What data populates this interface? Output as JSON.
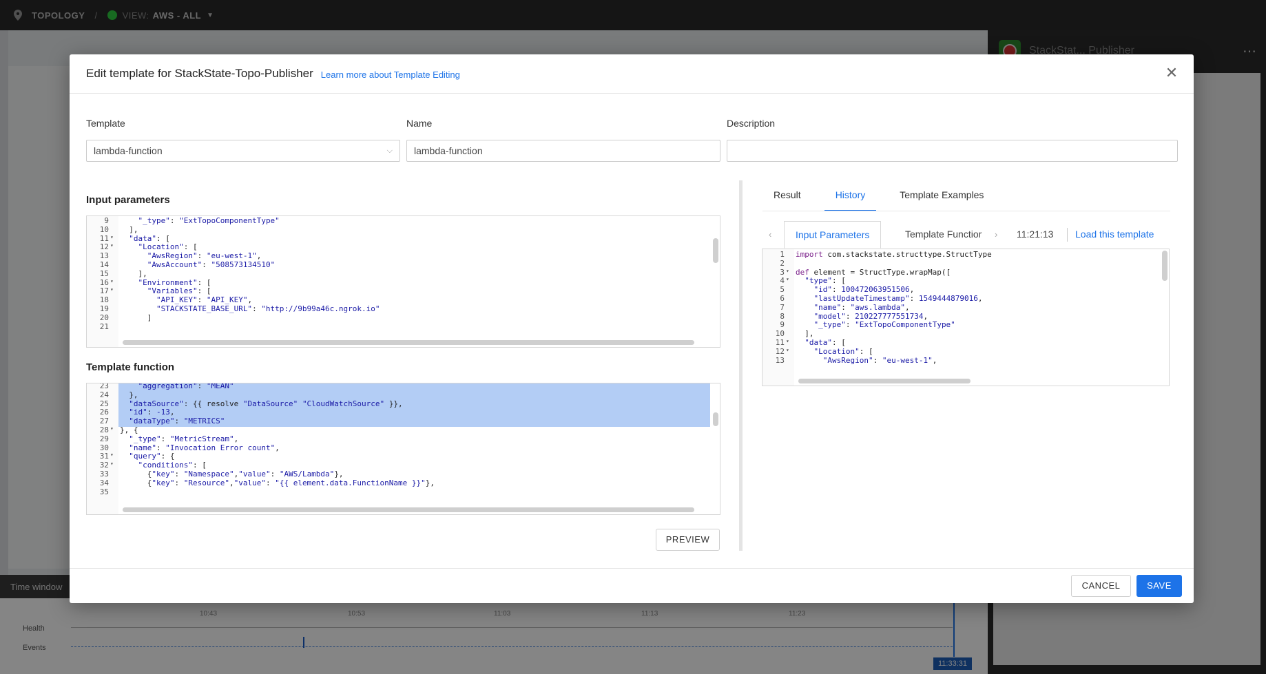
{
  "topbar": {
    "crumb": "TOPOLOGY",
    "separator": "/",
    "view_prefix": "VIEW:",
    "view_name": "AWS - ALL",
    "status_color": "#2ecc40"
  },
  "background": {
    "time_window_label": "Time window",
    "timeline": {
      "health_label": "Health",
      "events_label": "Events",
      "ticks": [
        "10:43",
        "10:53",
        "11:03",
        "11:13",
        "11:23"
      ],
      "current_time": "11:33:31"
    },
    "right_panel_title": "StackStat... Publisher"
  },
  "modal": {
    "title": "Edit template for StackState-Topo-Publisher",
    "learn_link": "Learn more about Template Editing",
    "fields": {
      "template_label": "Template",
      "template_value": "lambda-function",
      "name_label": "Name",
      "name_value": "lambda-function",
      "description_label": "Description",
      "description_value": ""
    },
    "input_parameters": {
      "title": "Input parameters",
      "lines": [
        {
          "n": "9",
          "fold": "",
          "text": "    \"_type\": \"ExtTopoComponentType\""
        },
        {
          "n": "10",
          "fold": "",
          "text": "  ],"
        },
        {
          "n": "11",
          "fold": "▾",
          "text": "  \"data\": ["
        },
        {
          "n": "12",
          "fold": "▾",
          "text": "    \"Location\": ["
        },
        {
          "n": "13",
          "fold": "",
          "text": "      \"AwsRegion\": \"eu-west-1\","
        },
        {
          "n": "14",
          "fold": "",
          "text": "      \"AwsAccount\": \"508573134510\""
        },
        {
          "n": "15",
          "fold": "",
          "text": "    ],"
        },
        {
          "n": "16",
          "fold": "▾",
          "text": "    \"Environment\": ["
        },
        {
          "n": "17",
          "fold": "▾",
          "text": "      \"Variables\": ["
        },
        {
          "n": "18",
          "fold": "",
          "text": "        \"API_KEY\": \"API_KEY\","
        },
        {
          "n": "19",
          "fold": "",
          "text": "        \"STACKSTATE_BASE_URL\": \"http://9b99a46c.ngrok.io\""
        },
        {
          "n": "20",
          "fold": "",
          "text": "      ]"
        },
        {
          "n": "21",
          "fold": "",
          "text": ""
        }
      ]
    },
    "template_function": {
      "title": "Template function",
      "lines": [
        {
          "n": "23",
          "fold": "",
          "text": "    \"aggregation\": \"MEAN\"",
          "sel": true
        },
        {
          "n": "24",
          "fold": "",
          "text": "  },",
          "sel": true
        },
        {
          "n": "25",
          "fold": "",
          "text": "  \"dataSource\": {{ resolve \"DataSource\" \"CloudWatchSource\" }},",
          "sel": true
        },
        {
          "n": "26",
          "fold": "",
          "text": "  \"id\": -13,",
          "sel": true
        },
        {
          "n": "27",
          "fold": "",
          "text": "  \"dataType\": \"METRICS\"",
          "sel": true
        },
        {
          "n": "28",
          "fold": "▾",
          "text": "}, {",
          "sel": false
        },
        {
          "n": "29",
          "fold": "",
          "text": "  \"_type\": \"MetricStream\",",
          "sel": false
        },
        {
          "n": "30",
          "fold": "",
          "text": "  \"name\": \"Invocation Error count\",",
          "sel": false
        },
        {
          "n": "31",
          "fold": "▾",
          "text": "  \"query\": {",
          "sel": false
        },
        {
          "n": "32",
          "fold": "▾",
          "text": "    \"conditions\": [",
          "sel": false
        },
        {
          "n": "33",
          "fold": "",
          "text": "      {\"key\": \"Namespace\",\"value\": \"AWS/Lambda\"},",
          "sel": false
        },
        {
          "n": "34",
          "fold": "",
          "text": "      {\"key\": \"Resource\",\"value\": \"{{ element.data.FunctionName }}\"},",
          "sel": false
        },
        {
          "n": "35",
          "fold": "",
          "text": "",
          "sel": false
        }
      ]
    },
    "preview_label": "PREVIEW",
    "right_tabs": [
      "Result",
      "History",
      "Template Examples"
    ],
    "active_right_tab": "History",
    "history": {
      "subtab_active": "Input Parameters",
      "subtab_other": "Template Functior",
      "prev_arrow": "‹",
      "next_arrow": "›",
      "timestamp": "11:21:13",
      "load_link": "Load this template",
      "lines": [
        {
          "n": "1",
          "fold": "",
          "text": "import com.stackstate.structtype.StructType"
        },
        {
          "n": "2",
          "fold": "",
          "text": ""
        },
        {
          "n": "3",
          "fold": "▾",
          "text": "def element = StructType.wrapMap(["
        },
        {
          "n": "4",
          "fold": "▾",
          "text": "  \"type\": ["
        },
        {
          "n": "5",
          "fold": "",
          "text": "    \"id\": 100472063951506,"
        },
        {
          "n": "6",
          "fold": "",
          "text": "    \"lastUpdateTimestamp\": 1549444879016,"
        },
        {
          "n": "7",
          "fold": "",
          "text": "    \"name\": \"aws.lambda\","
        },
        {
          "n": "8",
          "fold": "",
          "text": "    \"model\": 210227777551734,"
        },
        {
          "n": "9",
          "fold": "",
          "text": "    \"_type\": \"ExtTopoComponentType\""
        },
        {
          "n": "10",
          "fold": "",
          "text": "  ],"
        },
        {
          "n": "11",
          "fold": "▾",
          "text": "  \"data\": ["
        },
        {
          "n": "12",
          "fold": "▾",
          "text": "    \"Location\": ["
        },
        {
          "n": "13",
          "fold": "",
          "text": "      \"AwsRegion\": \"eu-west-1\","
        }
      ]
    },
    "cancel_label": "CANCEL",
    "save_label": "SAVE",
    "accent_color": "#1d73e8",
    "selection_color": "#b3cdf5"
  }
}
